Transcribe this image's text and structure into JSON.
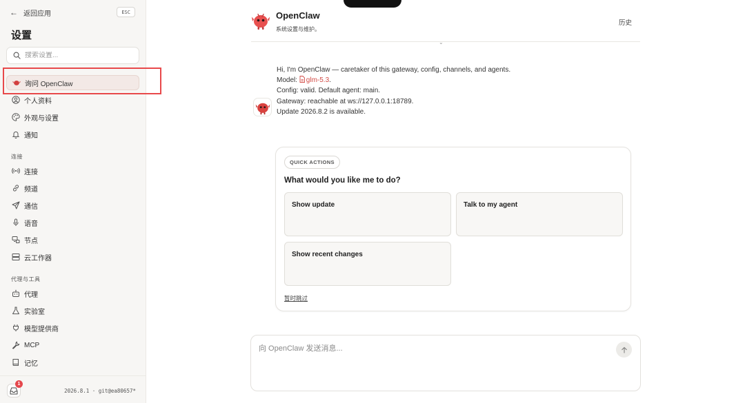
{
  "sidebar": {
    "back_label": "返回应用",
    "esc_label": "ESC",
    "title": "设置",
    "search_placeholder": "搜索设置...",
    "top_items": [
      {
        "label": "询问 OpenClaw",
        "icon": "openclaw-icon",
        "active": true
      },
      {
        "label": "个人资料",
        "icon": "user-icon"
      },
      {
        "label": "外观与设置",
        "icon": "palette-icon"
      },
      {
        "label": "通知",
        "icon": "bell-icon"
      }
    ],
    "section_connect": "连接",
    "connect_items": [
      {
        "label": "连接",
        "icon": "broadcast-icon"
      },
      {
        "label": "频道",
        "icon": "link-icon"
      },
      {
        "label": "通信",
        "icon": "send-icon"
      },
      {
        "label": "语音",
        "icon": "microphone-icon"
      },
      {
        "label": "节点",
        "icon": "nodes-icon"
      },
      {
        "label": "云工作器",
        "icon": "server-icon"
      }
    ],
    "section_agents": "代理与工具",
    "agent_items": [
      {
        "label": "代理",
        "icon": "robot-icon"
      },
      {
        "label": "实验室",
        "icon": "flask-icon"
      },
      {
        "label": "模型提供商",
        "icon": "plug-icon"
      },
      {
        "label": "MCP",
        "icon": "wrench-icon"
      },
      {
        "label": "记忆",
        "icon": "book-icon"
      }
    ],
    "inbox_badge": "1",
    "version": "2026.8.1 · git@ea80657*"
  },
  "header": {
    "app_name": "OpenClaw",
    "subtitle": "系统设置与维护。",
    "history_label": "历史"
  },
  "message": {
    "line1": "Hi, I'm OpenClaw — caretaker of this gateway, config, channels, and agents.",
    "model_prefix": "Model: ",
    "model_name": "glm-5.3",
    "model_suffix": ".",
    "line3": "Config: valid. Default agent: main.",
    "line4": "Gateway: reachable at ws://127.0.0.1:18789.",
    "line5": "Update 2026.8.2 is available."
  },
  "quick_actions": {
    "pill": "QUICK ACTIONS",
    "question": "What would you like me to do?",
    "buttons": [
      "Show update",
      "Talk to my agent",
      "Show recent changes"
    ],
    "skip_label": "暂时跳过"
  },
  "composer": {
    "placeholder": "向 OpenClaw 发送消息..."
  },
  "colors": {
    "accent": "#e5484d",
    "highlight": "#e8484a",
    "link": "#d24a45",
    "sidebar_bg": "#f7f6f4"
  }
}
